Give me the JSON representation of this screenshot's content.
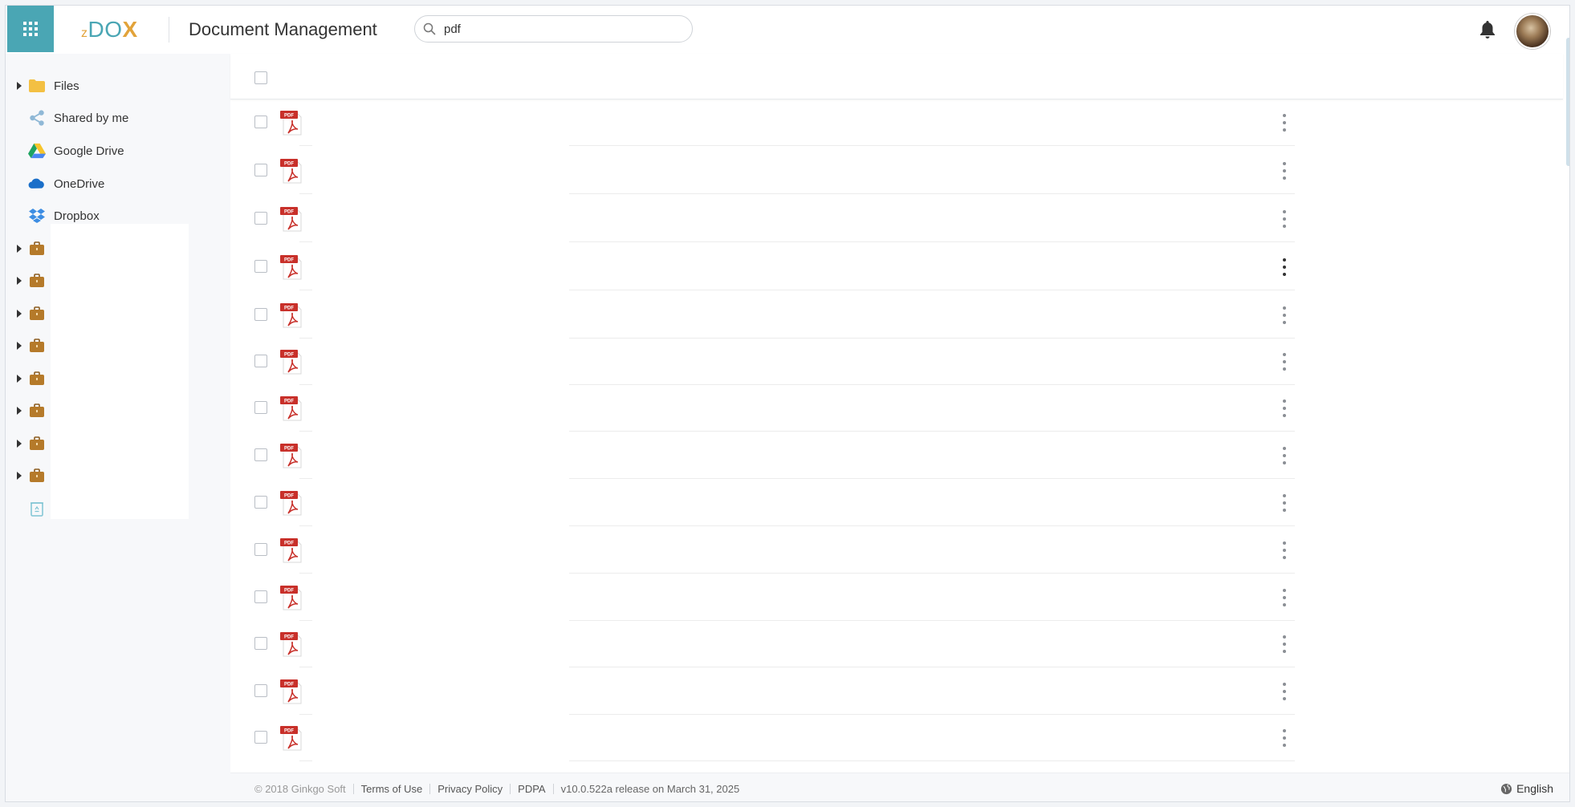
{
  "header": {
    "logo": {
      "z": "z",
      "d": "D",
      "o": "O",
      "x": "X"
    },
    "app_title": "Document Management",
    "search": {
      "value": "pdf",
      "placeholder": "Search"
    }
  },
  "sidebar": {
    "items": [
      {
        "label": "Files",
        "icon": "folder-icon"
      },
      {
        "label": "Shared by me",
        "icon": "share-icon"
      },
      {
        "label": "Google Drive",
        "icon": "google-drive-icon"
      },
      {
        "label": "OneDrive",
        "icon": "onedrive-icon"
      },
      {
        "label": "Dropbox",
        "icon": "dropbox-icon"
      }
    ],
    "cabinet_count": 8,
    "recycle_icon": "recycle-bin-icon"
  },
  "list": {
    "row_count": 14,
    "file_icon": "pdf-icon",
    "file_type_label": "PDF",
    "active_menu_row": 4
  },
  "footer": {
    "copyright": "© 2018 Ginkgo Soft",
    "terms": "Terms of Use",
    "privacy": "Privacy Policy",
    "pdpa": "PDPA",
    "version": "v10.0.522a release on March 31, 2025",
    "language": "English"
  },
  "colors": {
    "accent": "#4aa6b4",
    "logo_orange": "#e2a33a",
    "pdf_red": "#c8302a"
  }
}
